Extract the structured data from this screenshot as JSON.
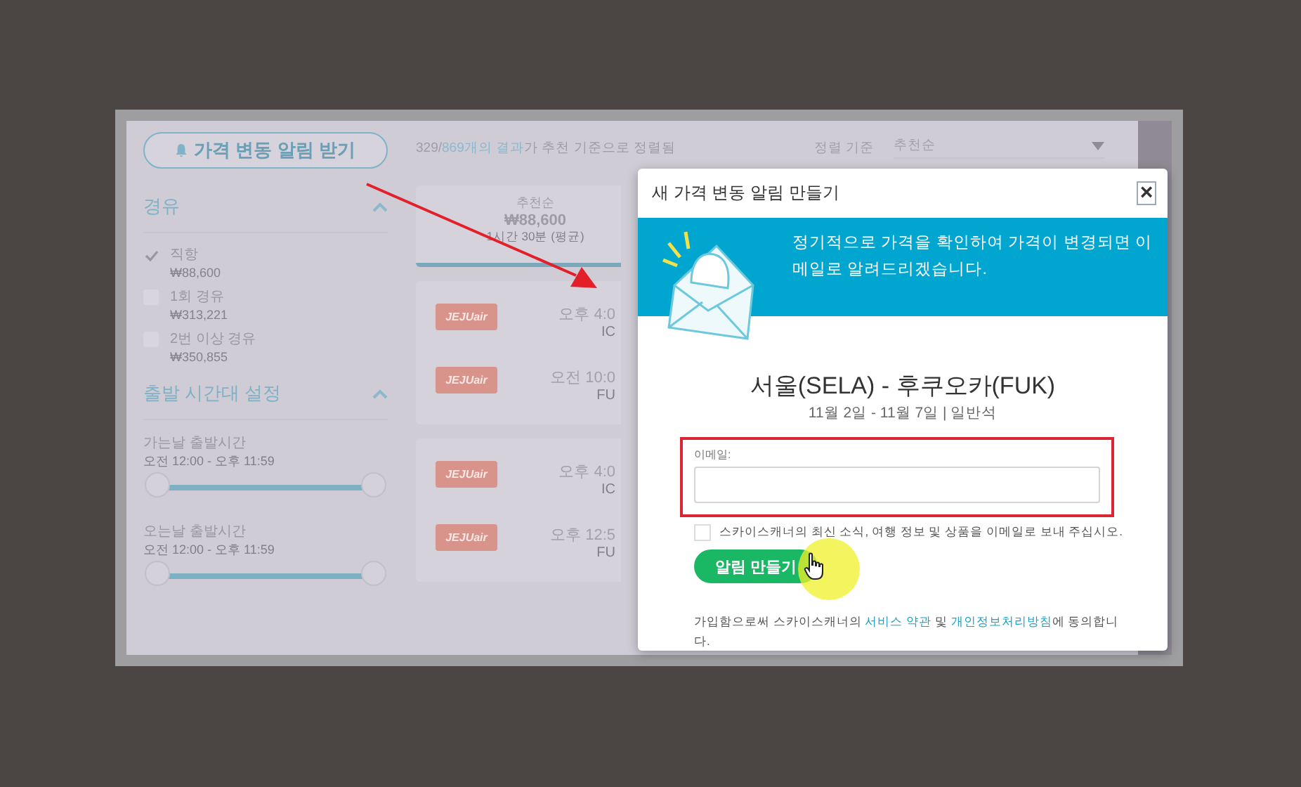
{
  "sidebar": {
    "alert_button": "가격 변동 알림 받기",
    "stops": {
      "title": "경유",
      "expanded": true,
      "options": [
        {
          "label": "직항",
          "price": "₩88,600",
          "checked": true
        },
        {
          "label": "1회 경유",
          "price": "₩313,221",
          "checked": false
        },
        {
          "label": "2번 이상 경유",
          "price": "₩350,855",
          "checked": false
        }
      ]
    },
    "times": {
      "title": "출발 시간대 설정",
      "expanded": true,
      "sliders": [
        {
          "label": "가는날 출발시간",
          "range": "오전 12:00 - 오후 11:59",
          "level": 1
        },
        {
          "label": "오는날 출발시간",
          "range": "오전 12:00 - 오후 11:59",
          "level": 1
        }
      ]
    }
  },
  "results": {
    "summary": {
      "prefix": "329/",
      "link": "869개의 결과",
      "suffix": "가 추천 기준으로 정렬됨"
    },
    "sort": {
      "label": "정렬 기준",
      "value": "추천순"
    },
    "sort_tabs": [
      {
        "title": "추천순",
        "price": "₩88,600",
        "duration": "1시간 30분 (평균)",
        "selected": true
      }
    ],
    "flights": [
      {
        "legs": [
          {
            "airline": "JEJUair",
            "time": "오후 4:0",
            "airport": "IC"
          },
          {
            "airline": "JEJUair",
            "time": "오전 10:0",
            "airport": "FU"
          }
        ]
      },
      {
        "legs": [
          {
            "airline": "JEJUair",
            "time": "오후 4:0",
            "airport": "IC"
          },
          {
            "airline": "JEJUair",
            "time": "오후 12:5",
            "airport": "FU"
          }
        ]
      }
    ]
  },
  "modal": {
    "title": "새 가격 변동 알림 만들기",
    "close": "×",
    "banner": "정기적으로 가격을 확인하여 가격이 변경되면 이메일로 알려드리겠습니다.",
    "route": "서울(SELA) - 후쿠오카(FUK)",
    "dates": "11월 2일 - 11월 7일 | 일반석",
    "email_label": "이메일:",
    "consent": {
      "label": "스카이스캐너의 최신 소식, 여행 정보 및 상품을 이메일로 보내 주십시오.",
      "checked": false
    },
    "submit": "알림 만들기",
    "terms": {
      "prefix": "가입함으로써 스카이스캐너의 ",
      "link1": "서비스 약관",
      "middle": " 및 ",
      "link2": "개인정보처리방침",
      "suffix": "에 동의합니다."
    }
  }
}
